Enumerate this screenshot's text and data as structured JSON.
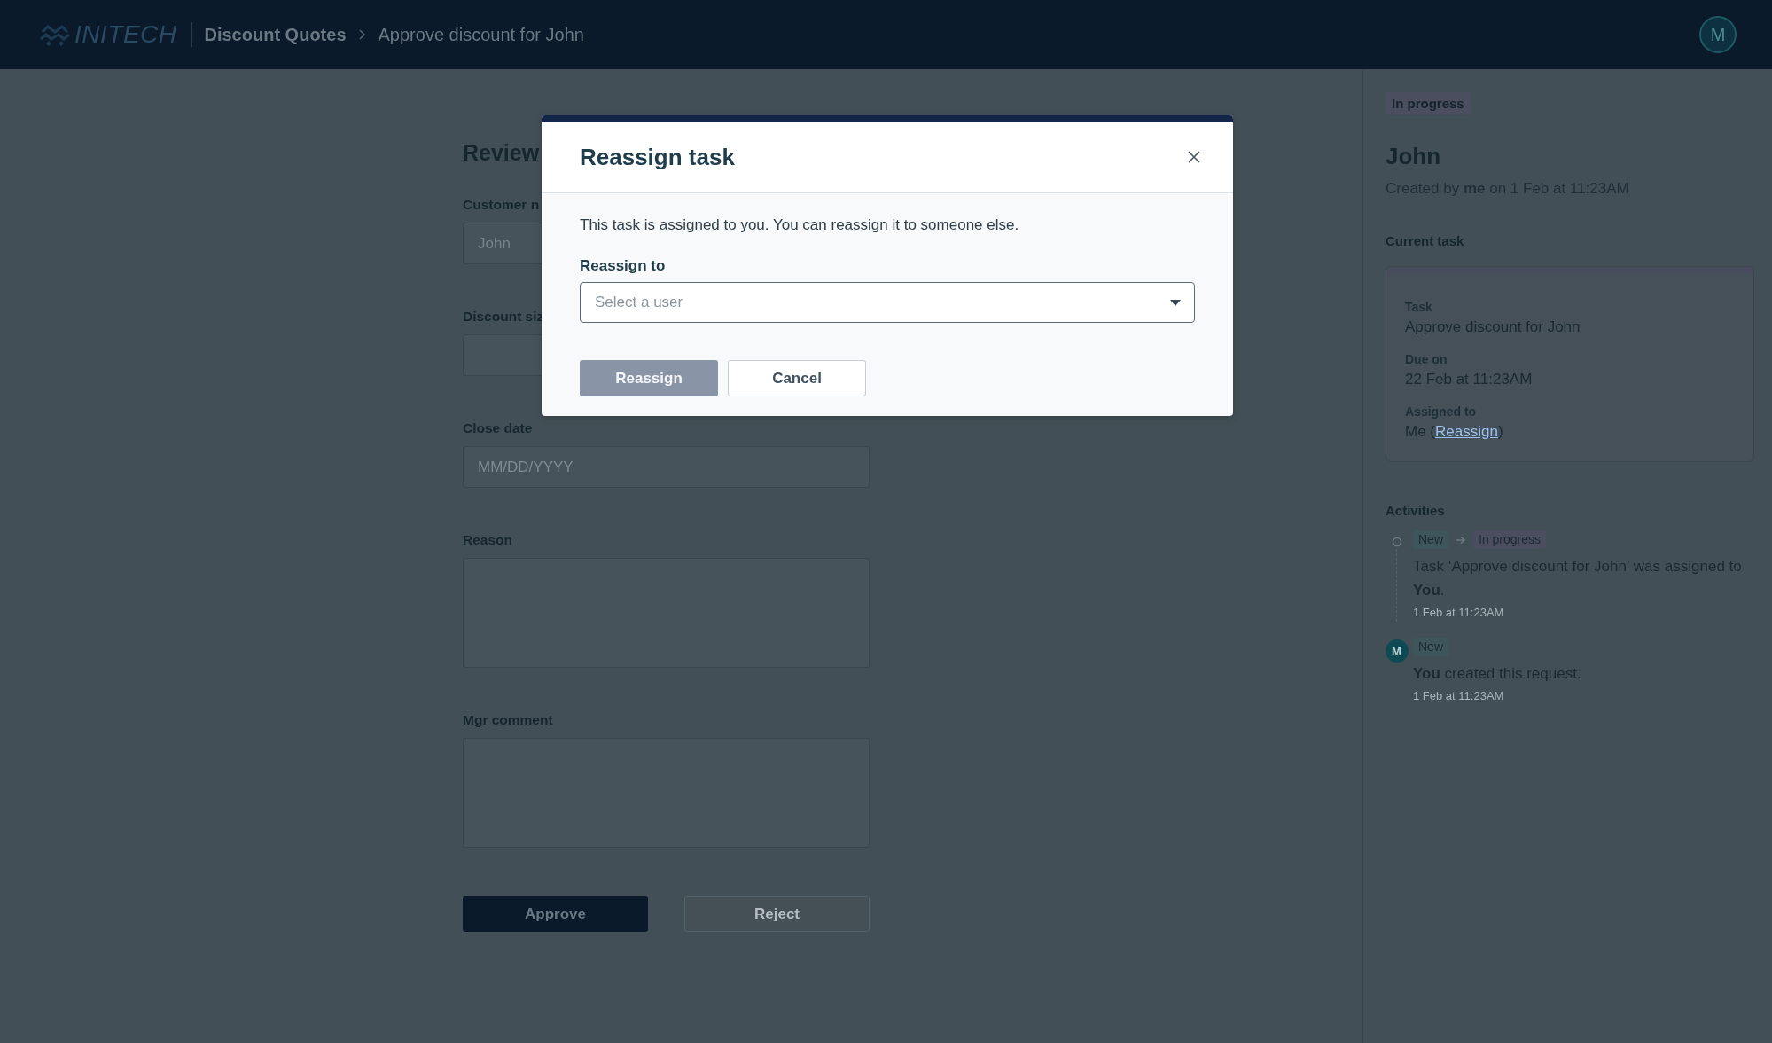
{
  "header": {
    "logo": "INITECH",
    "breadcrumb": [
      {
        "label": "Discount Quotes"
      },
      {
        "label": "Approve discount for John"
      }
    ],
    "avatar": "M"
  },
  "form": {
    "title": "Review",
    "fields": [
      {
        "label": "Customer n",
        "kind": "input",
        "value": "John"
      },
      {
        "label": "Discount siz",
        "kind": "input"
      },
      {
        "label": "Close date",
        "kind": "input",
        "placeholder": "MM/DD/YYYY"
      },
      {
        "label": "Reason",
        "kind": "textarea"
      },
      {
        "label": "Mgr comment",
        "kind": "textarea"
      }
    ],
    "buttons": [
      {
        "label": "Approve",
        "kind": "primary"
      },
      {
        "label": "Reject",
        "kind": "secondary"
      }
    ]
  },
  "sidebar": {
    "status": {
      "label": "In progress",
      "color": "#4b4e5f"
    },
    "title": "John",
    "created": "Created by **me** on 1 Feb at 11:23AM",
    "current_task": {
      "heading": "Current task",
      "fields": [
        {
          "label": "Task",
          "value": "Approve discount for John"
        },
        {
          "label": "Due on",
          "value": "22 Feb at 11:23AM"
        },
        {
          "label": "Assigned to",
          "prefix": "Me (",
          "link": "Reassign",
          "suffix": ")"
        }
      ]
    },
    "activities": {
      "heading": "Activities",
      "items": [
        {
          "kind": "status_change",
          "tags": [
            {
              "label": "New",
              "color": "#3f555c"
            },
            {
              "label": "In progress",
              "color": "#4b4e5f"
            }
          ],
          "text": "Task ‘Approve discount for John’ was assigned to **You**.",
          "time": "1 Feb at 11:23AM"
        },
        {
          "kind": "created",
          "avatar": "M",
          "tags": [
            {
              "label": "New",
              "color": "#3f555c"
            }
          ],
          "text": "**You** created this request.",
          "time": "1 Feb at 11:23AM"
        }
      ]
    }
  },
  "dialog": {
    "title": "Reassign task",
    "message": "This task is assigned to you. You can reassign it to someone else.",
    "select": {
      "label": "Reassign to",
      "placeholder": "Select a user"
    },
    "buttons": [
      {
        "label": "Reassign",
        "kind": "primary",
        "disabled": true
      },
      {
        "label": "Cancel",
        "kind": "secondary",
        "disabled": false
      }
    ]
  }
}
